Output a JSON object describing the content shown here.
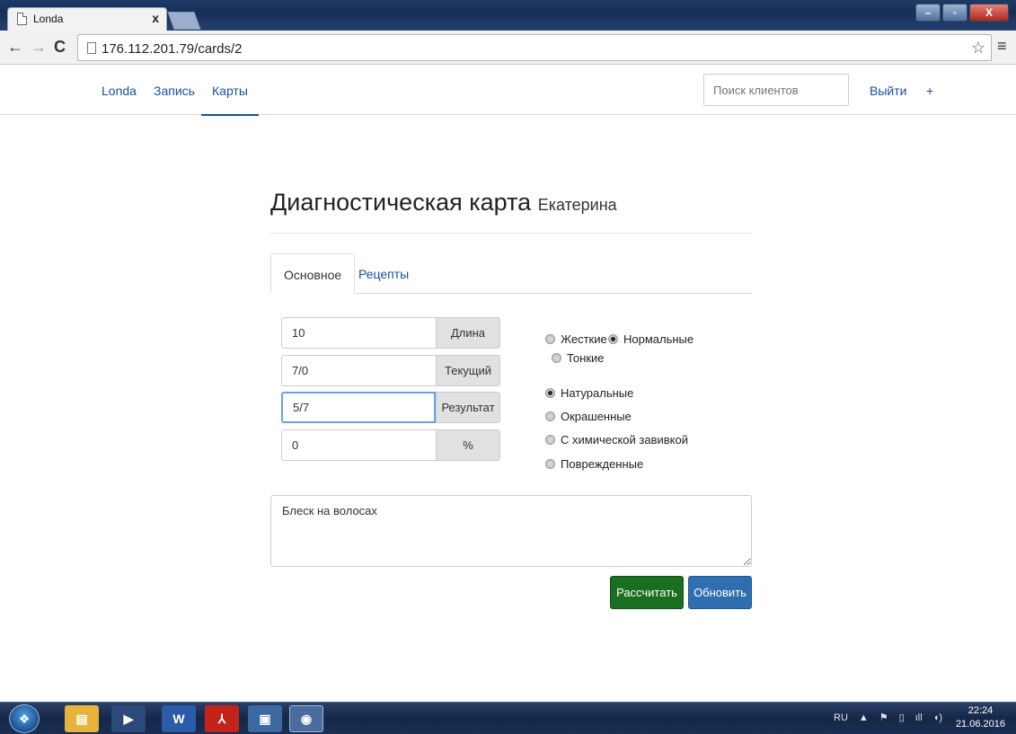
{
  "browser": {
    "tab_title": "Londa",
    "tab_close": "x",
    "url": "176.112.201.79/cards/2",
    "window_buttons": [
      "–",
      "▫",
      "X"
    ]
  },
  "nav": {
    "brand": "Londa",
    "links": [
      "Запись",
      "Карты"
    ],
    "search_placeholder": "Поиск клиентов",
    "logout": "Выйти",
    "plus": "+"
  },
  "page": {
    "title": "Диагностическая карта",
    "client": "Екатерина",
    "tabs": [
      "Основное",
      "Рецепты"
    ],
    "fields": [
      {
        "value": "10",
        "addon": "Длина"
      },
      {
        "value": "7/0",
        "addon": "Текущий"
      },
      {
        "value": "5/7",
        "addon": "Результат"
      },
      {
        "value": "0",
        "addon": "%"
      }
    ],
    "structure": {
      "options": [
        "Жесткие",
        "Нормальные",
        "Тонкие"
      ],
      "selected": "Нормальные"
    },
    "condition": {
      "options": [
        "Натуральные",
        "Окрашенные",
        "С химической завивкой",
        "Поврежденные"
      ],
      "selected": "Натуральные"
    },
    "notes": "Блеск на волосах",
    "calc_button": "Рассчитать",
    "update_button": "Обновить"
  },
  "taskbar": {
    "lang": "RU",
    "time": "22:24",
    "date": "21.06.2016"
  },
  "colors": {
    "link": "#1a4f9a",
    "green_button": "#1a6e1f",
    "blue_button": "#2f6fb0"
  }
}
